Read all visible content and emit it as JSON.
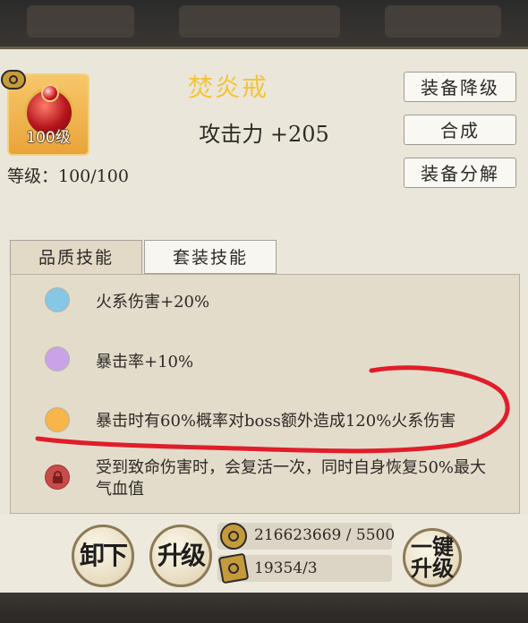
{
  "item": {
    "name": "焚炎戒",
    "level_badge": "100级",
    "attack": "攻击力 +205",
    "level_line": "等级：100/100"
  },
  "actions": {
    "downgrade": "装备降级",
    "combine": "合成",
    "decompose": "装备分解"
  },
  "tabs": [
    {
      "label": "品质技能"
    },
    {
      "label": "套装技能"
    }
  ],
  "skills": [
    {
      "text": "火系伤害+20%",
      "dot_color": "#86c7e6",
      "icon": "circle-dot-icon"
    },
    {
      "text": "暴击率+10%",
      "dot_color": "#c9a3e8",
      "icon": "circle-dot-icon"
    },
    {
      "text": "暴击时有60%概率对boss额外造成120%火系伤害",
      "dot_color": "#f7b54a",
      "icon": "circle-dot-icon"
    },
    {
      "text": "受到致命伤害时，会复活一次，同时自身恢复50%最大气血值",
      "dot_color": "#c64c49",
      "icon": "lock-icon"
    }
  ],
  "bottom": {
    "unequip": "卸下",
    "upgrade": "升级",
    "one_click_upgrade_line1": "一键",
    "one_click_upgrade_line2": "升级",
    "coins": "216623669 / 5500",
    "tickets": "19354/3"
  },
  "colors": {
    "item_name": "#f2c43a",
    "annotation": "#e01d2a"
  }
}
